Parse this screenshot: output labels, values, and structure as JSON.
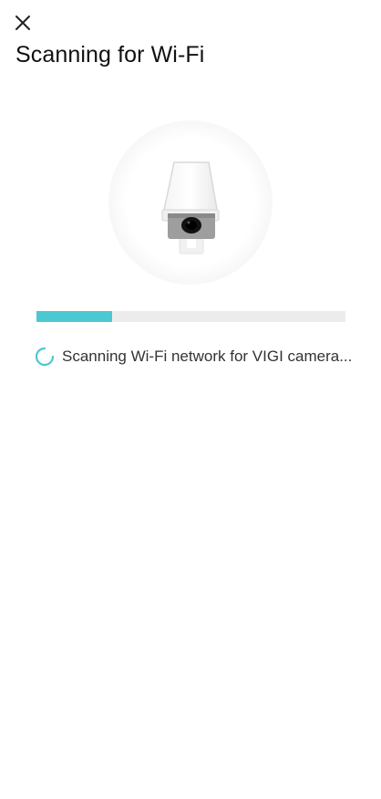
{
  "header": {
    "close_icon": "close-icon",
    "title": "Scanning for Wi-Fi"
  },
  "illustration": {
    "icon": "camera-icon"
  },
  "progress": {
    "fraction": 0.245,
    "color": "#4cc8d2",
    "track_color": "#ececec"
  },
  "status": {
    "icon": "loading-spinner-icon",
    "text": "Scanning Wi-Fi network for VIGI camera..."
  }
}
